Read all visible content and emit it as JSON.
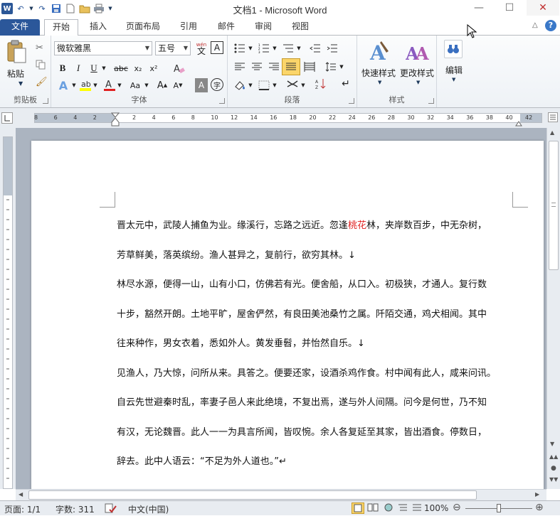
{
  "window": {
    "title": "文档1 - Microsoft Word"
  },
  "qat": {
    "logo": "W"
  },
  "tabs": [
    "文件",
    "开始",
    "插入",
    "页面布局",
    "引用",
    "邮件",
    "审阅",
    "视图"
  ],
  "ribbon": {
    "clipboard": {
      "label": "剪贴板",
      "paste": "粘贴"
    },
    "font": {
      "label": "字体",
      "font_name": "微软雅黑",
      "font_size": "五号",
      "pinyin": "wén",
      "bold": "B",
      "italic": "I",
      "underline": "U",
      "strike": "abc",
      "sub": "x₂",
      "sup": "x²",
      "grow": "A",
      "shrink": "A",
      "clear": "A",
      "case": "Aa",
      "char_border": "A",
      "char_shade": "A",
      "enclose": "字"
    },
    "paragraph": {
      "label": "段落"
    },
    "styles": {
      "label": "样式",
      "quick": "快速样式",
      "change": "更改样式"
    },
    "editing": {
      "label": "编辑",
      "name": "编辑"
    }
  },
  "ruler": {
    "numbers": [
      "8",
      "6",
      "4",
      "2",
      "2",
      "4",
      "6",
      "8",
      "10",
      "12",
      "14",
      "16",
      "18",
      "20",
      "22",
      "24",
      "26",
      "28",
      "30",
      "32",
      "34",
      "36",
      "38",
      "40",
      "42"
    ]
  },
  "document": {
    "lines": [
      {
        "pre": "晋太元中，武陵人捕鱼为业。缘溪行，忘路之远近。忽逢",
        "red": "桃花",
        "post": "林，夹岸数百步，中无杂树，"
      },
      {
        "pre": "芳草鲜美，落英缤纷。渔人甚异之，复前行，欲穷其林。↓",
        "red": "",
        "post": ""
      },
      {
        "pre": "林尽水源，便得一山，山有小口，仿佛若有光。便舍船，从口入。初极狭，才通人。复行数",
        "red": "",
        "post": ""
      },
      {
        "pre": "十步，豁然开朗。土地平旷，屋舍俨然，有良田美池桑竹之属。阡陌交通，鸡犬相闻。其中",
        "red": "",
        "post": ""
      },
      {
        "pre": "往来种作，男女衣着，悉如外人。黄发垂髫，并怡然自乐。↓",
        "red": "",
        "post": ""
      },
      {
        "pre": "见渔人，乃大惊，问所从来。具答之。便要还家，设酒杀鸡作食。村中闻有此人，咸来问讯。",
        "red": "",
        "post": ""
      },
      {
        "pre": "自云先世避秦时乱，率妻子邑人来此绝境，不复出焉，遂与外人间隔。问今是何世，乃不知",
        "red": "",
        "post": ""
      },
      {
        "pre": "有汉，无论魏晋。此人一一为具言所闻，皆叹惋。余人各复延至其家，皆出酒食。停数日，",
        "red": "",
        "post": ""
      },
      {
        "pre": "辞去。此中人语云：“不足为外人道也。”↵",
        "red": "",
        "post": ""
      }
    ]
  },
  "status": {
    "page": "页面: 1/1",
    "words": "字数: 311",
    "lang": "中文(中国)",
    "zoom": "100%"
  },
  "colors": {
    "accent": "#2b579a",
    "red_text": "#e02020"
  }
}
